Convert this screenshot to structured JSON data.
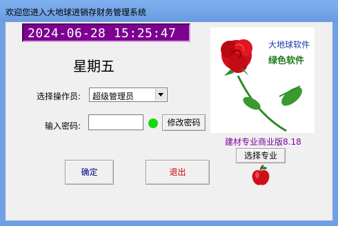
{
  "window": {
    "title": "欢迎您进入大地球进销存财务管理系统"
  },
  "clock": {
    "datetime": "2024-06-28 15:25:47",
    "weekday": "星期五"
  },
  "form": {
    "operator_label": "选择操作员:",
    "operator_value": "超级管理员",
    "password_label": "输入密码:",
    "password_value": "",
    "change_password_label": "修改密码",
    "status_color": "#16d80f"
  },
  "actions": {
    "confirm_label": "确定",
    "exit_label": "退出"
  },
  "branding": {
    "logo_line1": "大地球软件",
    "logo_line2": "绿色软件",
    "edition": "建材专业商业版8.18",
    "select_specialty_label": "选择专业",
    "logo_icon": "rose-icon",
    "app_icon": "apple-icon"
  }
}
